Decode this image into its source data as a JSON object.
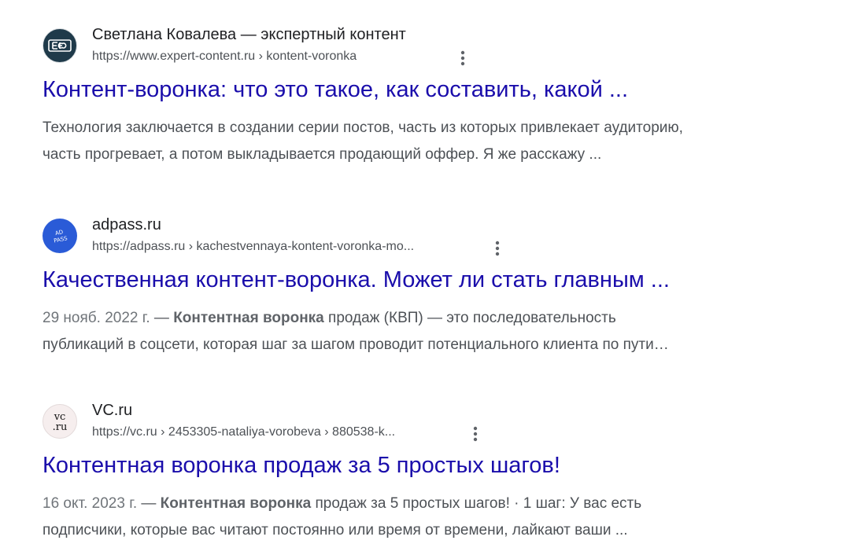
{
  "results": [
    {
      "site_name": "Светлана Ковалева — экспертный контент",
      "favicon_text": "ЕЮ",
      "url": "https://www.expert-content.ru › kontent-voronka",
      "title": "Контент-воронка: что это такое, как составить, какой ...",
      "snippet_line1": "Технология заключается в создании серии постов, часть из которых привлекает аудиторию,",
      "snippet_line2": "часть прогревает, а потом выкладывается продающий оффер. Я же расскажу ..."
    },
    {
      "site_name": "adpass.ru",
      "favicon_text": "ADPASS",
      "url": "https://adpass.ru › kachestvennaya-kontent-voronka-mo...",
      "title": "Качественная контент-воронка. Может ли стать главным ...",
      "date": "29 нояб. 2022 г.",
      "dash": " — ",
      "bold": "Контентная воронка",
      "snippet_rest1": " продаж (КВП) — это последовательность",
      "snippet_line2": "публикаций в соцсети, которая шаг за шагом проводит потенциального клиента по пути…"
    },
    {
      "site_name": "VC.ru",
      "favicon_text": "vc.ru",
      "url": "https://vc.ru › 2453305-nataliya-vorobeva › 880538-k...",
      "title": "Контентная воронка продаж за 5 простых шагов!",
      "date": "16 окт. 2023 г.",
      "dash": " — ",
      "bold": "Контентная воронка",
      "snippet_rest1": " продаж за 5 простых шагов! · 1 шаг: У вас есть",
      "snippet_line2": "подписчики, которые вас читают постоянно или время от времени, лайкают ваши ..."
    }
  ],
  "colors": {
    "link": "#1a0dab",
    "site_name": "#202124",
    "url": "#4d5156",
    "snippet": "#4d5156"
  },
  "icons": {
    "more": "more-vert-icon"
  }
}
